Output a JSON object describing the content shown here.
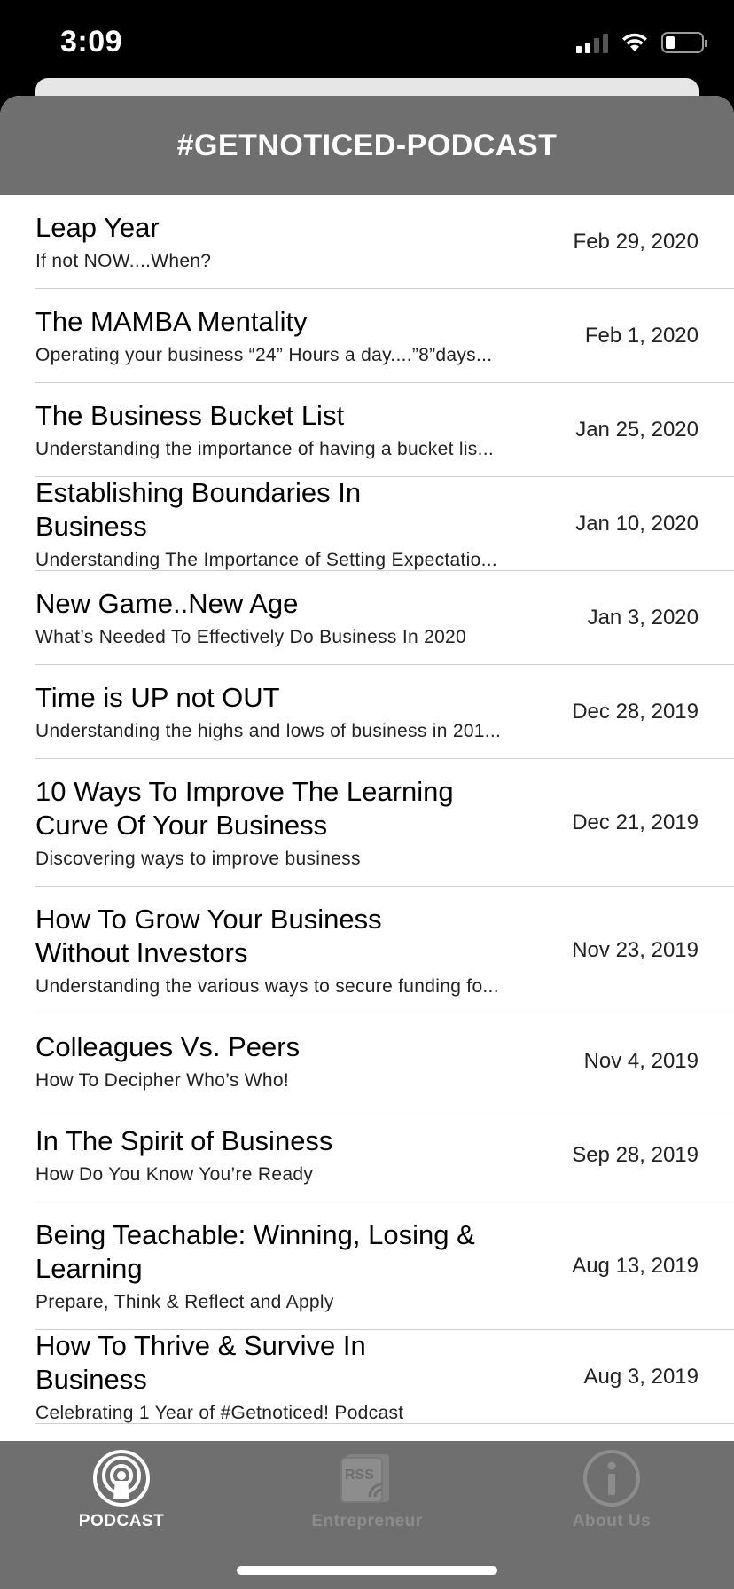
{
  "status": {
    "time": "3:09"
  },
  "header": {
    "title": "#GETNOTICED-PODCAST"
  },
  "episodes": [
    {
      "title": "Leap Year",
      "subtitle": "If not NOW....When?",
      "date": "Feb 29, 2020"
    },
    {
      "title": "The MAMBA Mentality",
      "subtitle": "Operating your business “24” Hours a day....”8”days...",
      "date": "Feb 1, 2020"
    },
    {
      "title": "The Business Bucket List",
      "subtitle": "Understanding the importance of having a bucket lis...",
      "date": "Jan 25, 2020"
    },
    {
      "title": "Establishing Boundaries In Business",
      "subtitle": "Understanding The Importance of Setting Expectatio...",
      "date": "Jan 10, 2020"
    },
    {
      "title": "New Game..New Age",
      "subtitle": "What’s Needed To Effectively Do Business In 2020",
      "date": "Jan 3, 2020"
    },
    {
      "title": "Time is UP not OUT",
      "subtitle": "Understanding the highs and lows of business in 201...",
      "date": "Dec 28, 2019"
    },
    {
      "title": "10 Ways To Improve The Learning Curve Of Your Business",
      "subtitle": "Discovering ways to improve business",
      "date": "Dec 21, 2019"
    },
    {
      "title": "How To Grow Your Business Without Investors",
      "subtitle": "Understanding the various ways to secure funding fo...",
      "date": "Nov 23, 2019"
    },
    {
      "title": "Colleagues Vs. Peers",
      "subtitle": "How To Decipher Who’s Who!",
      "date": "Nov 4, 2019"
    },
    {
      "title": "In The Spirit of Business",
      "subtitle": "How Do You Know You’re Ready",
      "date": "Sep 28, 2019"
    },
    {
      "title": "Being Teachable: Winning, Losing & Learning",
      "subtitle": "Prepare, Think & Reflect and Apply",
      "date": "Aug 13, 2019"
    },
    {
      "title": "How To Thrive & Survive In Business",
      "subtitle": "Celebrating 1 Year of #Getnoticed! Podcast",
      "date": "Aug 3, 2019"
    }
  ],
  "tabs": [
    {
      "label": "PODCAST",
      "icon": "podcast-icon",
      "active": true
    },
    {
      "label": "Entrepreneur",
      "icon": "rss-icon",
      "active": false
    },
    {
      "label": "About Us",
      "icon": "info-icon",
      "active": false
    }
  ]
}
